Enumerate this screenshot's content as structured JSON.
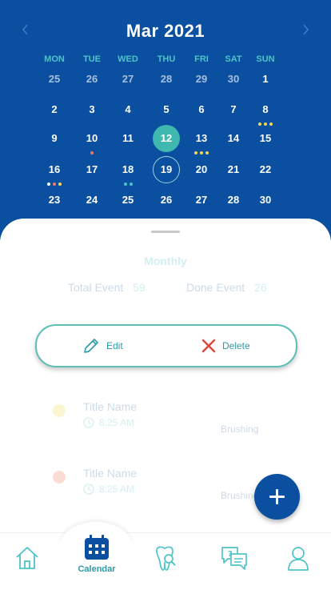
{
  "calendar": {
    "month_label": "Mar  2021",
    "prev_icon": "chevron-left-icon",
    "next_icon": "chevron-right-icon",
    "weekdays": [
      "MON",
      "TUE",
      "WED",
      "THU",
      "FRI",
      "SAT",
      "SUN"
    ],
    "weeks": [
      [
        {
          "d": "25",
          "muted": true
        },
        {
          "d": "26",
          "muted": true
        },
        {
          "d": "27",
          "muted": true
        },
        {
          "d": "28",
          "muted": true
        },
        {
          "d": "29",
          "muted": true
        },
        {
          "d": "30",
          "muted": true
        },
        {
          "d": "1"
        }
      ],
      [
        {
          "d": "2"
        },
        {
          "d": "3"
        },
        {
          "d": "4"
        },
        {
          "d": "5"
        },
        {
          "d": "6"
        },
        {
          "d": "7"
        },
        {
          "d": "8",
          "dots": [
            "#f2d94e",
            "#f2d94e",
            "#f2d94e"
          ]
        }
      ],
      [
        {
          "d": "9"
        },
        {
          "d": "10",
          "dots": [
            "#f07a5a"
          ]
        },
        {
          "d": "11"
        },
        {
          "d": "12",
          "today": true
        },
        {
          "d": "13",
          "dots": [
            "#f2d94e",
            "#f2d94e",
            "#f2d94e"
          ]
        },
        {
          "d": "14"
        },
        {
          "d": "15"
        }
      ],
      [
        {
          "d": "16",
          "dots": [
            "#ffffff",
            "#f07a5a",
            "#f2d94e"
          ]
        },
        {
          "d": "17"
        },
        {
          "d": "18",
          "dots": [
            "#4fc3c8",
            "#4fc3c8"
          ]
        },
        {
          "d": "19",
          "selected": true
        },
        {
          "d": "20"
        },
        {
          "d": "21"
        },
        {
          "d": "22"
        }
      ],
      [
        {
          "d": "23"
        },
        {
          "d": "24"
        },
        {
          "d": "25"
        },
        {
          "d": "26"
        },
        {
          "d": "27"
        },
        {
          "d": "28"
        },
        {
          "d": "30"
        }
      ]
    ]
  },
  "summary": {
    "period": "Monthly",
    "total_label": "Total Event",
    "total_value": "59",
    "done_label": "Done Event",
    "done_value": "26"
  },
  "actions": {
    "edit_label": "Edit",
    "edit_icon": "pencil-icon",
    "delete_label": "Delete",
    "delete_icon": "close-icon"
  },
  "events": [
    {
      "title": "Title Name",
      "time": "8:25 AM",
      "tag": "Brushing",
      "dot_color": "#f2d94e"
    },
    {
      "title": "Title Name",
      "time": "8:25 AM",
      "tag": "Brushing",
      "dot_color": "#f07a5a"
    }
  ],
  "fab": {
    "icon": "plus-icon"
  },
  "nav": {
    "items": [
      {
        "icon": "home-icon",
        "label": ""
      },
      {
        "icon": "calendar-icon",
        "label": "Calendar",
        "active": true
      },
      {
        "icon": "tooth-search-icon",
        "label": ""
      },
      {
        "icon": "chat-question-icon",
        "label": ""
      },
      {
        "icon": "user-icon",
        "label": ""
      }
    ]
  },
  "colors": {
    "primary_blue": "#0a4fa0",
    "teal": "#4fc3c8",
    "today_fill": "#3fb8b0",
    "delete_red": "#e0443a"
  }
}
